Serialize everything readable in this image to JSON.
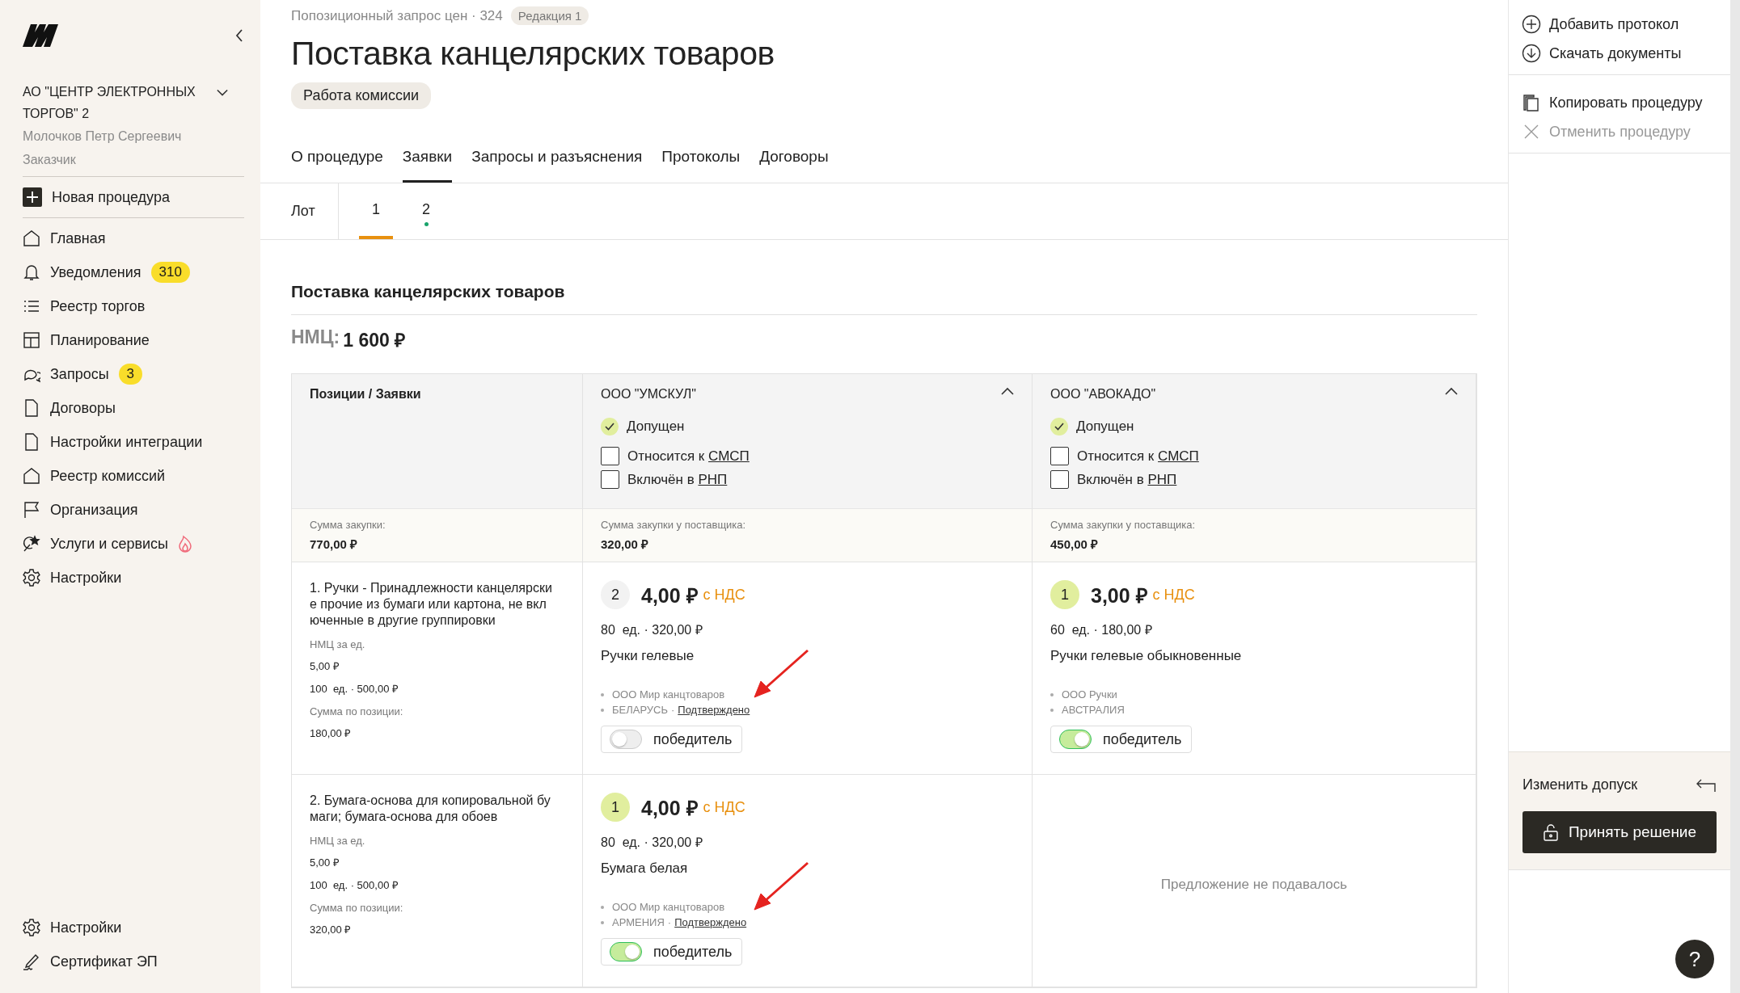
{
  "sidebar": {
    "organization": {
      "name": "АО \"ЦЕНТР ЭЛЕКТРОННЫХ ТОРГОВ\" 2",
      "user": "Молочков Петр Сергеевич",
      "role": "Заказчик"
    },
    "new_button": "Новая процедура",
    "items": [
      {
        "label": "Главная",
        "selected": false
      },
      {
        "label": "Уведомления",
        "badge": "310",
        "selected": false
      },
      {
        "label": "Реестр торгов",
        "selected": false
      },
      {
        "label": "Планирование",
        "selected": false
      },
      {
        "label": "Запросы",
        "badge": "3",
        "selected": false
      },
      {
        "label": "Договоры",
        "selected": false
      },
      {
        "label": "Настройки интеграции",
        "selected": false
      },
      {
        "label": "Реестр комиссий",
        "selected": false
      },
      {
        "label": "Организация",
        "selected": false
      },
      {
        "label": "Услуги и сервисы",
        "hot": true,
        "selected": false
      },
      {
        "label": "Настройки",
        "selected": false
      }
    ],
    "bottom_items": [
      {
        "label": "Настройки",
        "selected": false
      },
      {
        "label": "Сертификат ЭП",
        "selected": false
      }
    ]
  },
  "header": {
    "breadcrumb": "Попозиционный запрос цен · 324",
    "edition": "Редакция 1",
    "title": "Поставка канцелярских товаров",
    "status": "Работа комиссии"
  },
  "tabs": [
    {
      "label": "О процедуре",
      "selected": false
    },
    {
      "label": "Заявки",
      "selected": true
    },
    {
      "label": "Запросы и разъяснения",
      "selected": false
    },
    {
      "label": "Протоколы",
      "selected": false
    },
    {
      "label": "Договоры",
      "selected": false
    }
  ],
  "lots": {
    "label": "Лот",
    "items": [
      {
        "label": "1",
        "selected": true,
        "marked": false
      },
      {
        "label": "2",
        "selected": false,
        "marked": true
      }
    ]
  },
  "section": {
    "title": "Поставка канцелярских товаров",
    "nmc_label": "НМЦ:",
    "nmc_value": "1 600 ₽"
  },
  "table": {
    "corner_header": "Позиции / Заявки",
    "corner_sum_label": "Сумма закупки:",
    "corner_sum": "770,00 ₽",
    "suppliers": [
      {
        "name": "ООО \"УМСКУЛ\"",
        "expanded": true,
        "admitted": true,
        "admitted_label": "Допущен",
        "checks": [
          {
            "text": "Относится к",
            "link": "СМСП",
            "checked": false
          },
          {
            "text": "Включён в",
            "link": "РНП",
            "checked": false
          }
        ],
        "sum_label": "Сумма закупки у поставщика:",
        "sum": "320,00 ₽"
      },
      {
        "name": "ООО \"АВОКАДО\"",
        "expanded": true,
        "admitted": true,
        "admitted_label": "Допущен",
        "checks": [
          {
            "text": "Относится к",
            "link": "СМСП",
            "checked": false
          },
          {
            "text": "Включён в",
            "link": "РНП",
            "checked": false
          }
        ],
        "sum_label": "Сумма закупки у поставщика:",
        "sum": "450,00 ₽"
      }
    ],
    "positions": [
      {
        "title": "1. Ручки - Принадлежности канцелярские прочие из бумаги или картона, не включенные в другие группировки",
        "unit_label": "НМЦ за ед.",
        "unit_price": "5,00 ₽",
        "quantity": "100  ед. · 500,00 ₽",
        "sum_label": "Сумма по позиции:",
        "sum": "180,00 ₽",
        "offers": [
          {
            "kind": "offer",
            "rank": "2",
            "best": false,
            "price": "4,00 ₽",
            "vat": "с НДС",
            "quantity": "80  ед. · 320,00 ₽",
            "name": "Ручки гелевые",
            "maker": "ООО Мир канцтоваров",
            "country": "БЕЛАРУСЬ",
            "separator": "·",
            "confirmed": "Подтверждено",
            "winner": false,
            "winner_label": "победитель",
            "annotated": true
          },
          {
            "kind": "offer",
            "rank": "1",
            "best": true,
            "price": "3,00 ₽",
            "vat": "с НДС",
            "quantity": "60  ед. · 180,00 ₽",
            "name": "Ручки гелевые обыкновенные",
            "maker": "ООО Ручки",
            "country": "АВСТРАЛИЯ",
            "winner": true,
            "winner_label": "победитель",
            "annotated": false
          }
        ]
      },
      {
        "title": "2. Бумага-основа для копировальной бумаги; бумага-основа для обоев",
        "unit_label": "НМЦ за ед.",
        "unit_price": "5,00 ₽",
        "quantity": "100  ед. · 500,00 ₽",
        "sum_label": "Сумма по позиции:",
        "sum": "320,00 ₽",
        "offers": [
          {
            "kind": "offer",
            "rank": "1",
            "best": true,
            "price": "4,00 ₽",
            "vat": "с НДС",
            "quantity": "80  ед. · 320,00 ₽",
            "name": "Бумага белая",
            "maker": "ООО Мир канцтоваров",
            "country": "АРМЕНИЯ",
            "separator": "·",
            "confirmed": "Подтверждено",
            "winner": true,
            "winner_label": "победитель",
            "annotated": true
          },
          {
            "kind": "empty",
            "text": "Предложение не подавалось"
          }
        ]
      }
    ]
  },
  "actions": [
    {
      "label": "Добавить протокол",
      "disabled": false
    },
    {
      "label": "Скачать документы",
      "disabled": false
    }
  ],
  "procedure_actions": [
    {
      "label": "Копировать процедуру",
      "disabled": false
    },
    {
      "label": "Отменить процедуру",
      "disabled": true
    }
  ],
  "decision": {
    "change_label": "Изменить допуск",
    "button": "Принять решение"
  },
  "help": "?"
}
